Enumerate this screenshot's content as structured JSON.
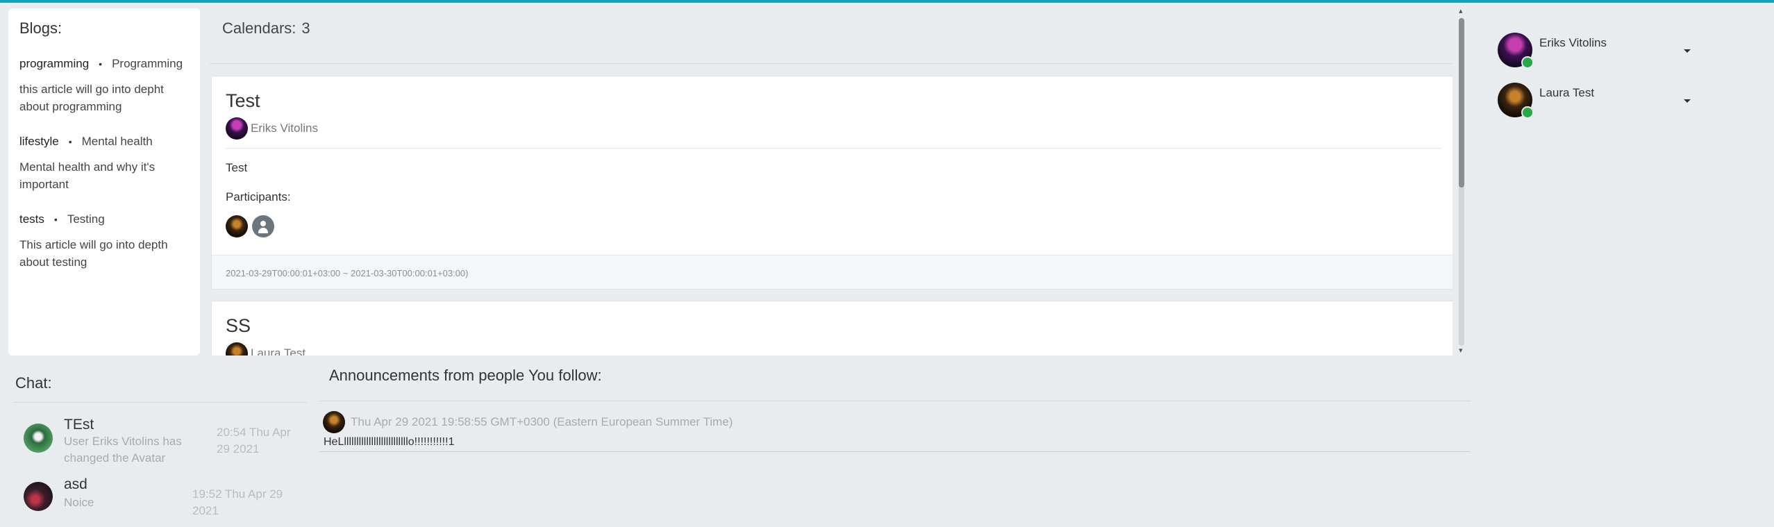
{
  "blogs": {
    "title": "Blogs:",
    "items": [
      {
        "category": "programming",
        "title": "Programming",
        "description": "this article will go into depht about programming"
      },
      {
        "category": "lifestyle",
        "title": "Mental health",
        "description": "Mental health and why it's important"
      },
      {
        "category": "tests",
        "title": "Testing",
        "description": "This article will go into depth about testing"
      }
    ]
  },
  "calendars": {
    "label": "Calendars:",
    "count": "3",
    "events": [
      {
        "title": "Test",
        "author": "Eriks Vitolins",
        "description": "Test",
        "participants_label": "Participants:",
        "timespan": "2021-03-29T00:00:01+03:00 ~ 2021-03-30T00:00:01+03:00)"
      },
      {
        "title": "SS",
        "author": "Laura Test"
      }
    ]
  },
  "friends": [
    {
      "name": "Eriks Vitolins",
      "status": "online"
    },
    {
      "name": "Laura Test",
      "status": "online"
    }
  ],
  "chat": {
    "title": "Chat:",
    "items": [
      {
        "name": "TEst",
        "message": "User Eriks Vitolins has changed the Avatar",
        "time": "20:54 Thu Apr 29 2021"
      },
      {
        "name": "asd",
        "message": "Noice",
        "time": "19:52 Thu Apr 29 2021"
      }
    ]
  },
  "announcements": {
    "title": "Announcements from people You follow:",
    "items": [
      {
        "date": "Thu Apr 29 2021 19:58:55 GMT+0300 (Eastern European Summer Time)",
        "text": "HeLllllllllllllllllllllllllllo!!!!!!!!!!!1"
      }
    ]
  },
  "colors": {
    "accent_bar": "#17a2b8",
    "online": "#28a745",
    "background": "#e9ecef"
  }
}
